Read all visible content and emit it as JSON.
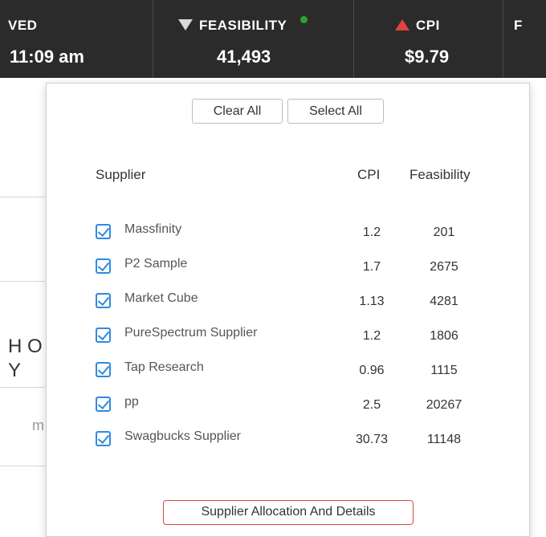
{
  "header": {
    "saved": {
      "label": "VED",
      "value": "11:09 am"
    },
    "feasibility": {
      "label": "FEASIBILITY",
      "value": "41,493",
      "trend": "down",
      "status_dot": "#2aa52a"
    },
    "cpi": {
      "label": "CPI",
      "value": "$9.79",
      "trend": "up",
      "trend_color": "#e0453b"
    },
    "next": {
      "label": "F"
    }
  },
  "background": {
    "fragment_1": "H O",
    "fragment_2": "Y",
    "fragment_3": "m"
  },
  "popup": {
    "clear_all": "Clear All",
    "select_all": "Select All",
    "columns": {
      "supplier": "Supplier",
      "cpi": "CPI",
      "feasibility": "Feasibility"
    },
    "suppliers": [
      {
        "name": "Massfinity",
        "cpi": "1.2",
        "feasibility": "201",
        "checked": true
      },
      {
        "name": "P2 Sample",
        "cpi": "1.7",
        "feasibility": "2675",
        "checked": true
      },
      {
        "name": "Market Cube",
        "cpi": "1.13",
        "feasibility": "4281",
        "checked": true
      },
      {
        "name": "PureSpectrum Supplier",
        "cpi": "1.2",
        "feasibility": "1806",
        "checked": true
      },
      {
        "name": "Tap Research",
        "cpi": "0.96",
        "feasibility": "1115",
        "checked": true
      },
      {
        "name": "pp",
        "cpi": "2.5",
        "feasibility": "20267",
        "checked": true
      },
      {
        "name": "Swagbucks Supplier",
        "cpi": "30.73",
        "feasibility": "11148",
        "checked": true
      }
    ],
    "allocation_button": "Supplier Allocation And Details",
    "accent_color": "#2f8ae0"
  }
}
